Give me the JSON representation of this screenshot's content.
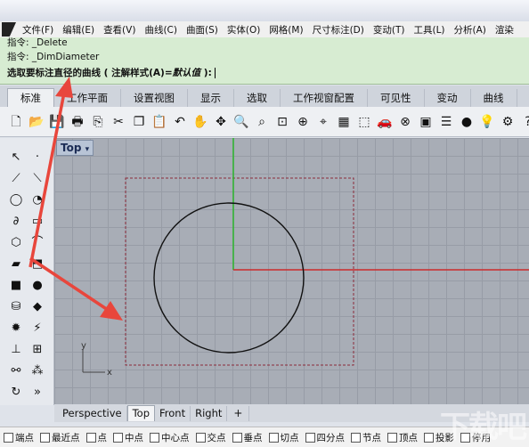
{
  "menu": {
    "items": [
      "文件(F)",
      "编辑(E)",
      "查看(V)",
      "曲线(C)",
      "曲面(S)",
      "实体(O)",
      "网格(M)",
      "尺寸标注(D)",
      "变动(T)",
      "工具(L)",
      "分析(A)",
      "渲染"
    ]
  },
  "command": {
    "line1": "指令: _Delete",
    "line2": "指令: _DimDiameter",
    "prompt": "选取要标注直径的曲线 ( 注解样式(A)=",
    "prompt_option": "默认值",
    "prompt_end": " ):"
  },
  "tabs": {
    "items": [
      "标准",
      "工作平面",
      "设置视图",
      "显示",
      "选取",
      "工作视窗配置",
      "可见性",
      "变动",
      "曲线"
    ],
    "active_index": 0
  },
  "viewport": {
    "label": "Top",
    "axis_y": "y",
    "axis_x": "x"
  },
  "viewport_tabs": {
    "items": [
      "Perspective",
      "Top",
      "Front",
      "Right"
    ],
    "active_index": 1,
    "add_label": "+"
  },
  "osnap": {
    "items": [
      "端点",
      "最近点",
      "点",
      "中点",
      "中心点",
      "交点",
      "垂点",
      "切点",
      "四分点",
      "节点",
      "顶点",
      "投影",
      "停用"
    ]
  },
  "watermark": "下载吧",
  "colors": {
    "command_bg": "#d7ecd2",
    "grid_bg": "#a8adb6",
    "red_arrow": "#e8463c",
    "axis_x": "#cc2b2b",
    "axis_y": "#2bb52b"
  }
}
